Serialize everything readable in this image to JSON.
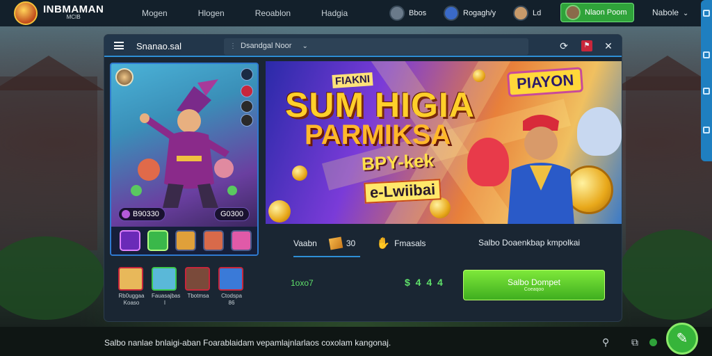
{
  "topbar": {
    "brand_name": "INBMAMAN",
    "brand_sub": "MCIB",
    "nav": [
      "Mogen",
      "Hlogen",
      "Reoablon",
      "Hadgia"
    ],
    "users": [
      {
        "label": "Bbos"
      },
      {
        "label": "Rogagh/y"
      },
      {
        "label": "Ld"
      }
    ],
    "login_label": "Nlaon Poom",
    "language": "Nabole"
  },
  "panel": {
    "title": "Snanao.sal",
    "search_value": "Dsandgal Noor"
  },
  "left_card": {
    "stat_left": "B90330",
    "stat_right": "G0300"
  },
  "banner": {
    "tag": "FIAKNI",
    "title_line1": "SUM HIGIA",
    "title_line2": "PARMIKSA",
    "title_line3": "BPY-kek",
    "title_line4": "e-Lwiibai",
    "badge": "PIAYON"
  },
  "info": {
    "tab_label": "Vaabn",
    "box_count": "30",
    "hand_label": "Fmasals",
    "right_label": "Salbo Doaenkbap kmpolkai"
  },
  "thumbs": [
    {
      "label": "Rb0uggaa Koaso"
    },
    {
      "label": "Fauasajbas I"
    },
    {
      "label": "Tbotmsa"
    },
    {
      "label": "Ctodspa 86"
    }
  ],
  "purchase": {
    "balance": "1oxo7",
    "price": "$ 4 4 4",
    "cta_label": "Salbo Dompet",
    "cta_sub": "Coeaqoo"
  },
  "footer": {
    "text": "Salbo nanlae bnlaigi-aban Foarablaidam vepamlajnlarlaos coxolam kangonaj."
  },
  "colors": {
    "accent_blue": "#2e8fd6",
    "accent_green": "#3fae1f",
    "panel_bg": "#1a2633",
    "topbar_bg": "#13202b"
  },
  "icons": {
    "menu": "hamburger-icon",
    "search": "search-icon",
    "notifications": "bell-icon",
    "close": "close-icon",
    "chat": "chat-icon"
  }
}
